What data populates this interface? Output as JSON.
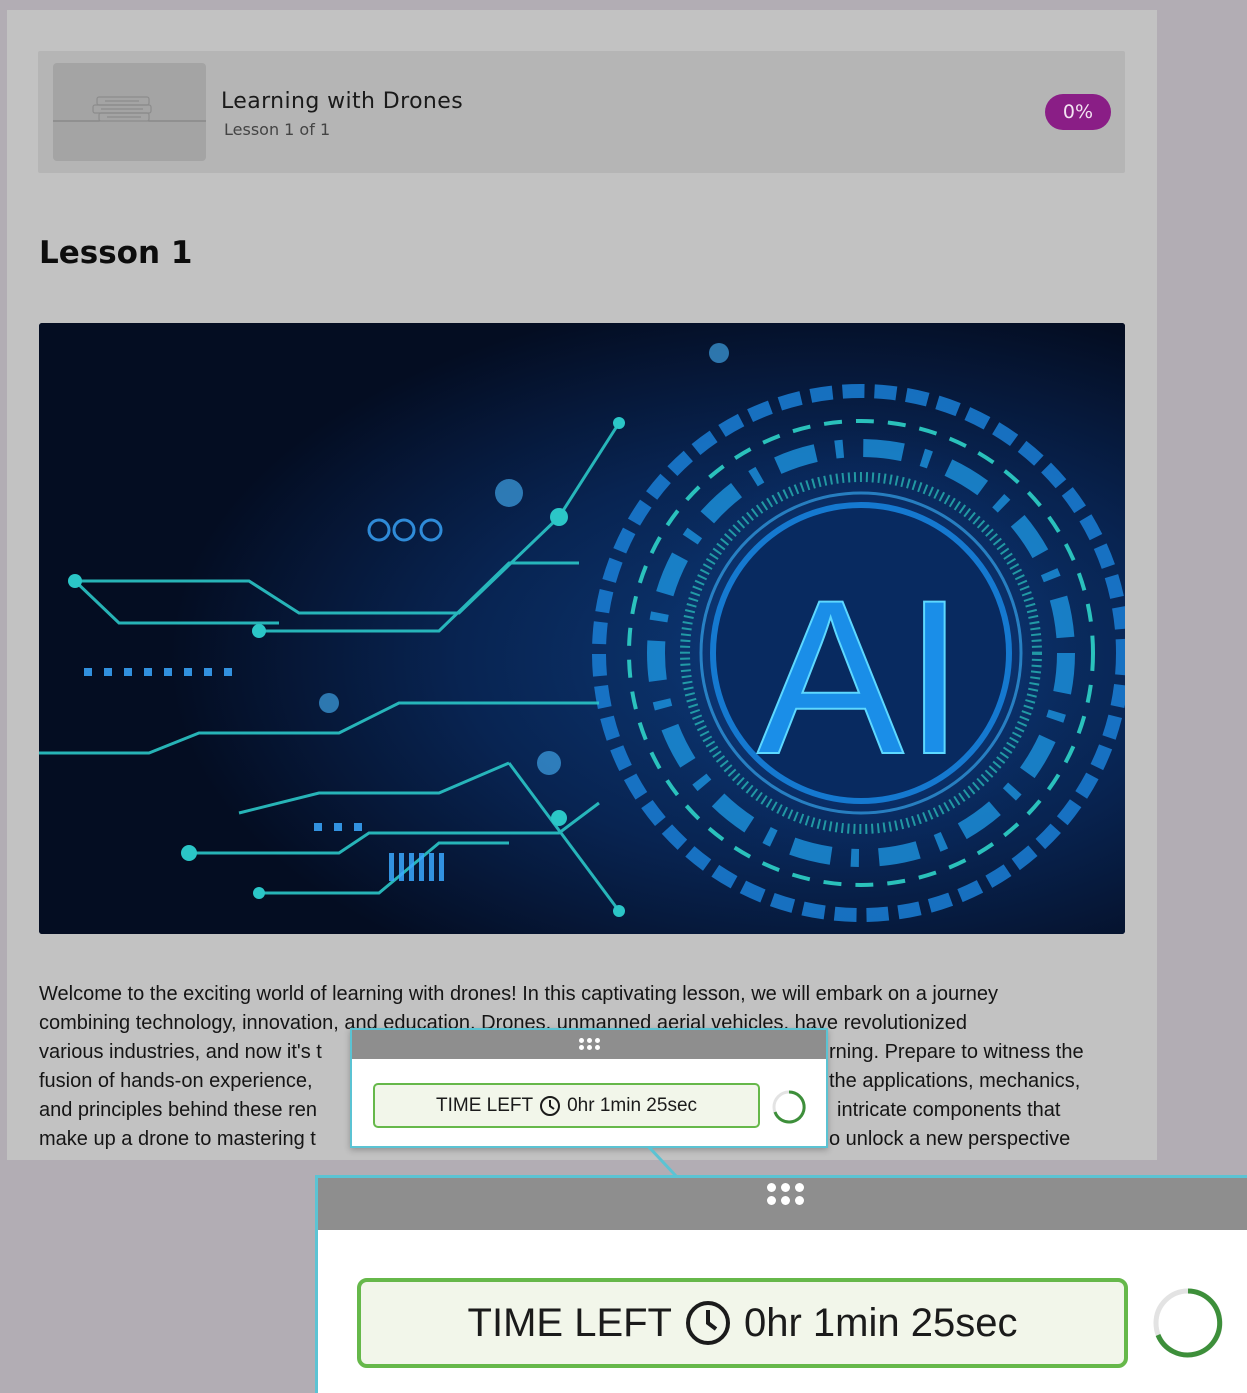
{
  "course": {
    "title": "Learning with Drones",
    "subtitle": "Lesson 1 of 1",
    "progress_label": "0%",
    "progress_percent": 0,
    "thumbnail_icon": "books-stack-icon"
  },
  "lesson": {
    "heading": "Lesson 1",
    "hero_image_text": "AI",
    "body_lines": [
      "Welcome to the exciting world of learning with drones! In this captivating lesson, we will embark on a journey",
      "combining technology, innovation, and education. Drones, unmanned aerial vehicles, have revolutionized",
      "various industries, and now it's t",
      "fusion of hands-on experience,",
      "and principles behind these ren",
      "make up a drone to mastering t"
    ],
    "body_lines_right": [
      "",
      "",
      "rning. Prepare to witness the",
      "the applications, mechanics,",
      "intricate components that",
      "o unlock a new perspective"
    ]
  },
  "timer": {
    "label": "TIME LEFT",
    "value": "0hr 1min 25sec",
    "clock_icon": "clock-icon",
    "drag_icon": "drag-handle-icon",
    "spinner_icon": "loading-spinner-icon"
  },
  "colors": {
    "progress_badge": "#8a1e86",
    "timer_border": "#66b84a",
    "widget_outline": "#5bc3d3",
    "overlay_bg": "#b2adb4"
  }
}
